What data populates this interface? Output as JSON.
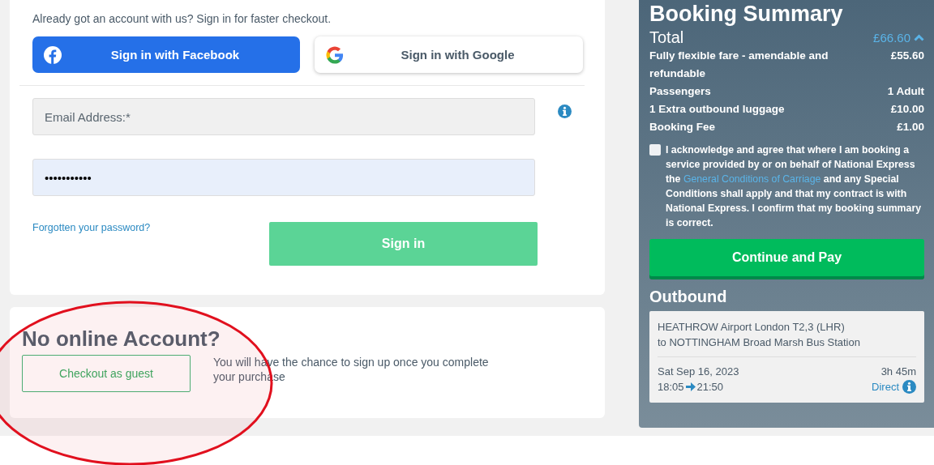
{
  "signin": {
    "intro": "Already got an account with us? Sign in for faster checkout.",
    "facebook_button": "Sign in with Facebook",
    "google_button": "Sign in with Google",
    "email": {
      "placeholder": "Email Address:*"
    },
    "password": {
      "value": "•••••••••••"
    },
    "forgot_link": "Forgotten your password?",
    "signin_button": "Sign in"
  },
  "guest": {
    "title": "No online Account?",
    "button": "Checkout as guest",
    "note": "You will have the chance to sign up once you complete your purchase"
  },
  "summary": {
    "title": "Booking Summary",
    "total_label": "Total",
    "total_value": "£66.60",
    "expanded": true,
    "lines": [
      {
        "label": "Fully flexible fare - amendable and refundable",
        "value": "£55.60"
      },
      {
        "label": "Passengers",
        "value": "1 Adult"
      },
      {
        "label": "1 Extra outbound luggage",
        "value": "£10.00"
      },
      {
        "label": "Booking Fee",
        "value": "£1.00"
      }
    ],
    "terms": {
      "checked": false,
      "text_before": "I acknowledge and agree that where I am booking a service provided by or on behalf of National Express the",
      "link": "General Conditions of Carriage",
      "text_after": "and any Special Conditions shall apply and that my contract is with National Express. I confirm that my booking summary is correct."
    },
    "pay_button": "Continue and Pay",
    "outbound": {
      "title": "Outbound",
      "route": [
        "HEATHROW Airport London T2,3 (LHR)",
        "to NOTTINGHAM Broad Marsh Bus Station"
      ],
      "date": "Sat Sep 16, 2023",
      "depart": "18:05",
      "arrive": "21:50",
      "duration": "3h 45m",
      "type": "Direct"
    }
  }
}
